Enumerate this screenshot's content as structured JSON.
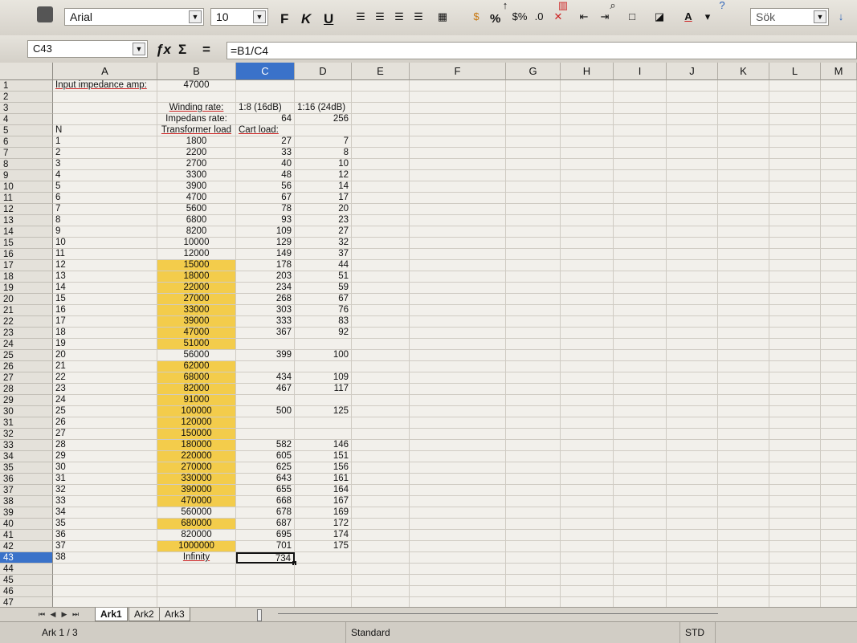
{
  "toolbar": {
    "font_name": "Arial",
    "font_size": "10",
    "bold": "F",
    "italic": "K",
    "underline": "U",
    "percent": "%",
    "search_placeholder": "Sök"
  },
  "formula_bar": {
    "cell_ref": "C43",
    "fx": "ƒx",
    "sum": "Σ",
    "equals": "=",
    "formula": "=B1/C4"
  },
  "columns": [
    "A",
    "B",
    "C",
    "D",
    "E",
    "F",
    "G",
    "H",
    "I",
    "J",
    "K",
    "L",
    "M"
  ],
  "selected_column": "C",
  "rows": [
    {
      "n": "1",
      "a": "Input impedance amp:",
      "b": "47000",
      "c": "",
      "d": "",
      "hl": false
    },
    {
      "n": "2",
      "a": "",
      "b": "",
      "c": "",
      "d": "",
      "hl": false
    },
    {
      "n": "3",
      "a": "",
      "b": "Winding rate:",
      "c": "1:8 (16dB)",
      "d": "1:16 (24dB)",
      "hl": false
    },
    {
      "n": "4",
      "a": "",
      "b": "Impedans rate:",
      "c": "64",
      "d": "256",
      "hl": false
    },
    {
      "n": "5",
      "a": "N",
      "b": "Transformer load",
      "c": "Cart load:",
      "d": "",
      "hl": false
    },
    {
      "n": "6",
      "a": "1",
      "b": "1800",
      "c": "27",
      "d": "7",
      "hl": false
    },
    {
      "n": "7",
      "a": "2",
      "b": "2200",
      "c": "33",
      "d": "8",
      "hl": false
    },
    {
      "n": "8",
      "a": "3",
      "b": "2700",
      "c": "40",
      "d": "10",
      "hl": false
    },
    {
      "n": "9",
      "a": "4",
      "b": "3300",
      "c": "48",
      "d": "12",
      "hl": false
    },
    {
      "n": "10",
      "a": "5",
      "b": "3900",
      "c": "56",
      "d": "14",
      "hl": false
    },
    {
      "n": "11",
      "a": "6",
      "b": "4700",
      "c": "67",
      "d": "17",
      "hl": false
    },
    {
      "n": "12",
      "a": "7",
      "b": "5600",
      "c": "78",
      "d": "20",
      "hl": false
    },
    {
      "n": "13",
      "a": "8",
      "b": "6800",
      "c": "93",
      "d": "23",
      "hl": false
    },
    {
      "n": "14",
      "a": "9",
      "b": "8200",
      "c": "109",
      "d": "27",
      "hl": false
    },
    {
      "n": "15",
      "a": "10",
      "b": "10000",
      "c": "129",
      "d": "32",
      "hl": false
    },
    {
      "n": "16",
      "a": "11",
      "b": "12000",
      "c": "149",
      "d": "37",
      "hl": false
    },
    {
      "n": "17",
      "a": "12",
      "b": "15000",
      "c": "178",
      "d": "44",
      "hl": true
    },
    {
      "n": "18",
      "a": "13",
      "b": "18000",
      "c": "203",
      "d": "51",
      "hl": true
    },
    {
      "n": "19",
      "a": "14",
      "b": "22000",
      "c": "234",
      "d": "59",
      "hl": true
    },
    {
      "n": "20",
      "a": "15",
      "b": "27000",
      "c": "268",
      "d": "67",
      "hl": true
    },
    {
      "n": "21",
      "a": "16",
      "b": "33000",
      "c": "303",
      "d": "76",
      "hl": true
    },
    {
      "n": "22",
      "a": "17",
      "b": "39000",
      "c": "333",
      "d": "83",
      "hl": true
    },
    {
      "n": "23",
      "a": "18",
      "b": "47000",
      "c": "367",
      "d": "92",
      "hl": true
    },
    {
      "n": "24",
      "a": "19",
      "b": "51000",
      "c": "",
      "d": "",
      "hl": true
    },
    {
      "n": "25",
      "a": "20",
      "b": "56000",
      "c": "399",
      "d": "100",
      "hl": false
    },
    {
      "n": "26",
      "a": "21",
      "b": "62000",
      "c": "",
      "d": "",
      "hl": true
    },
    {
      "n": "27",
      "a": "22",
      "b": "68000",
      "c": "434",
      "d": "109",
      "hl": true
    },
    {
      "n": "28",
      "a": "23",
      "b": "82000",
      "c": "467",
      "d": "117",
      "hl": true
    },
    {
      "n": "29",
      "a": "24",
      "b": "91000",
      "c": "",
      "d": "",
      "hl": true
    },
    {
      "n": "30",
      "a": "25",
      "b": "100000",
      "c": "500",
      "d": "125",
      "hl": true
    },
    {
      "n": "31",
      "a": "26",
      "b": "120000",
      "c": "",
      "d": "",
      "hl": true
    },
    {
      "n": "32",
      "a": "27",
      "b": "150000",
      "c": "",
      "d": "",
      "hl": true
    },
    {
      "n": "33",
      "a": "28",
      "b": "180000",
      "c": "582",
      "d": "146",
      "hl": true
    },
    {
      "n": "34",
      "a": "29",
      "b": "220000",
      "c": "605",
      "d": "151",
      "hl": true
    },
    {
      "n": "35",
      "a": "30",
      "b": "270000",
      "c": "625",
      "d": "156",
      "hl": true
    },
    {
      "n": "36",
      "a": "31",
      "b": "330000",
      "c": "643",
      "d": "161",
      "hl": true
    },
    {
      "n": "37",
      "a": "32",
      "b": "390000",
      "c": "655",
      "d": "164",
      "hl": true
    },
    {
      "n": "38",
      "a": "33",
      "b": "470000",
      "c": "668",
      "d": "167",
      "hl": true
    },
    {
      "n": "39",
      "a": "34",
      "b": "560000",
      "c": "678",
      "d": "169",
      "hl": false
    },
    {
      "n": "40",
      "a": "35",
      "b": "680000",
      "c": "687",
      "d": "172",
      "hl": true
    },
    {
      "n": "41",
      "a": "36",
      "b": "820000",
      "c": "695",
      "d": "174",
      "hl": false
    },
    {
      "n": "42",
      "a": "37",
      "b": "1000000",
      "c": "701",
      "d": "175",
      "hl": true
    },
    {
      "n": "43",
      "a": "38",
      "b": "Infinity",
      "c": "734",
      "d": "",
      "hl": false
    },
    {
      "n": "44",
      "a": "",
      "b": "",
      "c": "",
      "d": "",
      "hl": false
    },
    {
      "n": "45",
      "a": "",
      "b": "",
      "c": "",
      "d": "",
      "hl": false
    },
    {
      "n": "46",
      "a": "",
      "b": "",
      "c": "",
      "d": "",
      "hl": false
    },
    {
      "n": "47",
      "a": "",
      "b": "",
      "c": "",
      "d": "",
      "hl": false
    }
  ],
  "active_cell": {
    "row": "43",
    "col": "C"
  },
  "sheets": [
    "Ark1",
    "Ark2",
    "Ark3"
  ],
  "active_sheet": "Ark1",
  "status": {
    "sheet_info": "Ark 1 / 3",
    "page_style": "Standard",
    "mode": "STD"
  },
  "colors": {
    "highlight": "#f3cc4b",
    "selection": "#3a72c9"
  }
}
